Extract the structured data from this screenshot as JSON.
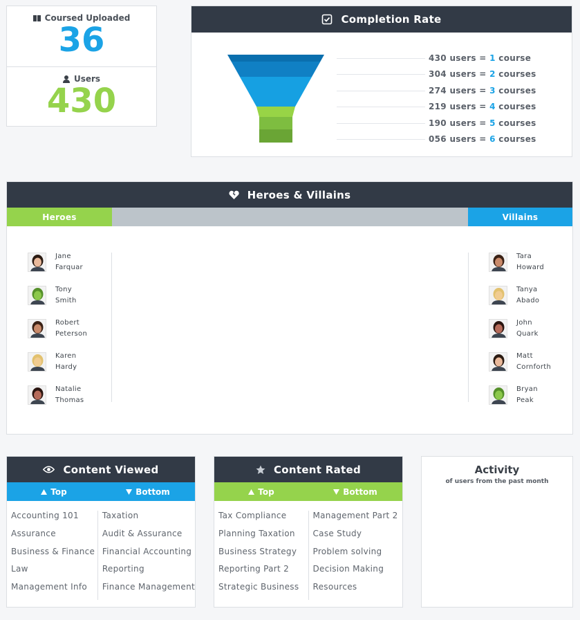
{
  "stats": {
    "courses_label": "Coursed Uploaded",
    "courses_value": "36",
    "users_label": "Users",
    "users_value": "430"
  },
  "completion": {
    "title": "Completion Rate",
    "rows": [
      {
        "count": "430",
        "mid": "users =",
        "num": "1",
        "unit": "course"
      },
      {
        "count": "304",
        "mid": "users =",
        "num": "2",
        "unit": "courses"
      },
      {
        "count": "274",
        "mid": "users =",
        "num": "3",
        "unit": "courses"
      },
      {
        "count": "219",
        "mid": "users =",
        "num": "4",
        "unit": "courses"
      },
      {
        "count": "190",
        "mid": "users =",
        "num": "5",
        "unit": "courses"
      },
      {
        "count": "056",
        "mid": "users =",
        "num": "6",
        "unit": "courses"
      }
    ],
    "funnel_colors": [
      "#0a6fae",
      "#1080c4",
      "#16a0e2",
      "#98d446",
      "#7ebd40",
      "#6aa535"
    ]
  },
  "hv": {
    "title": "Heroes & Villains",
    "heroes_label": "Heroes",
    "villains_label": "Villains",
    "heroes": [
      {
        "first": "Jane",
        "last": "Farquar"
      },
      {
        "first": "Tony",
        "last": "Smith"
      },
      {
        "first": "Robert",
        "last": "Peterson"
      },
      {
        "first": "Karen",
        "last": "Hardy"
      },
      {
        "first": "Natalie",
        "last": "Thomas"
      }
    ],
    "villains": [
      {
        "first": "Tara",
        "last": "Howard"
      },
      {
        "first": "Tanya",
        "last": "Abado"
      },
      {
        "first": "John",
        "last": "Quark"
      },
      {
        "first": "Matt",
        "last": "Cornforth"
      },
      {
        "first": "Bryan",
        "last": "Peak"
      }
    ]
  },
  "viewed": {
    "title": "Content Viewed",
    "top_label": "Top",
    "bottom_label": "Bottom",
    "top": [
      "Accounting 101",
      "Assurance",
      "Business & Finance",
      "Law",
      "Management Info"
    ],
    "bottom": [
      "Taxation",
      "Audit & Assurance",
      "Financial Accounting",
      "Reporting",
      "Finance Management"
    ]
  },
  "rated": {
    "title": "Content Rated",
    "top_label": "Top",
    "bottom_label": "Bottom",
    "top": [
      "Tax Compliance",
      "Planning Taxation",
      "Business Strategy",
      "Reporting Part 2",
      "Strategic Business"
    ],
    "bottom": [
      "Management Part 2",
      "Case Study",
      "Problem solving",
      "Decision Making",
      "Resources"
    ]
  },
  "activity": {
    "title": "Activity",
    "subtitle": "of users from the past month"
  },
  "colors": {
    "blue": "#1ba3e6",
    "green": "#95d34c",
    "header": "#323a46",
    "gray_bar": "#bcc4ca"
  }
}
